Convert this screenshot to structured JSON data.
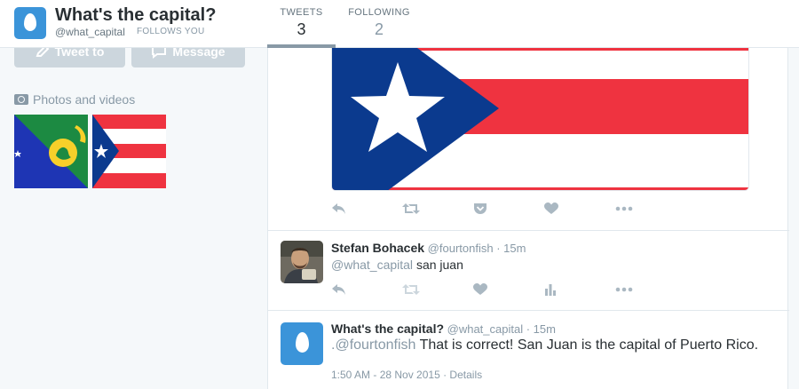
{
  "profile": {
    "name": "What's the capital?",
    "handle": "@what_capital",
    "follows_you": "FOLLOWS YOU"
  },
  "nav": {
    "tweets_label": "TWEETS",
    "tweets_count": "3",
    "following_label": "FOLLOWING",
    "following_count": "2"
  },
  "sidebar": {
    "tweet_to_label": "Tweet to",
    "message_label": "Message",
    "photos_label": "Photos and videos",
    "thumbnails": [
      "christmas-island-flag",
      "puerto-rico-flag"
    ]
  },
  "tweets": [
    {
      "media": "puerto-rico-flag",
      "actions": [
        "reply-icon",
        "retweet-icon",
        "pocket-icon",
        "like-icon",
        "more-icon"
      ]
    },
    {
      "name": "Stefan Bohacek",
      "handle": "@fourtonfish",
      "time": "· 15m",
      "mention": "@what_capital",
      "text": "san juan",
      "actions": [
        "reply-icon",
        "retweet-icon",
        "like-icon",
        "analytics-icon",
        "more-icon"
      ]
    },
    {
      "name": "What's the capital?",
      "handle": "@what_capital",
      "time": "· 15m",
      "prefix": ".",
      "mention": "@fourtonfish",
      "text": "That is correct! San Juan is the capital of Puerto Rico.",
      "timestamp": "1:50 AM - 28 Nov 2015",
      "details": "· Details"
    }
  ],
  "colors": {
    "accent": "#3b94d9",
    "pr_red": "#ef3340",
    "pr_blue": "#0b3a8e",
    "cx_green": "#1c8a42",
    "cx_blue": "#1e35b4",
    "cx_yellow": "#f7d02a"
  }
}
